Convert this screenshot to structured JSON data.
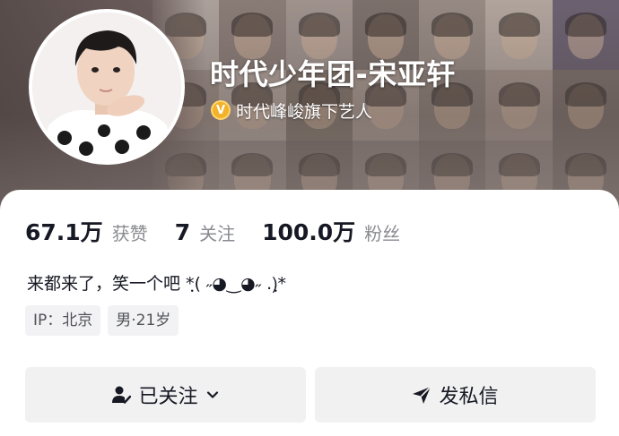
{
  "profile": {
    "nickname": "时代少年团-宋亚轩",
    "verified_badge": "V",
    "verified_text": "时代峰峻旗下艺人",
    "bio": "来都来了，笑一个吧 *ฺ( ˶◕‿◕˶ .)ฺ*"
  },
  "stats": [
    {
      "value": "67.1万",
      "label": "获赞"
    },
    {
      "value": "7",
      "label": "关注"
    },
    {
      "value": "100.0万",
      "label": "粉丝"
    }
  ],
  "tags": [
    {
      "text": "IP：北京"
    },
    {
      "text": "男·21岁"
    }
  ],
  "actions": {
    "follow_label": "已关注",
    "follow_icon": "user-check-icon",
    "follow_chevron_icon": "chevron-down-icon",
    "message_label": "发私信",
    "message_icon": "send-icon"
  },
  "colors": {
    "verified": "#f3b229",
    "text": "#161823",
    "muted": "#8a8b91",
    "button_bg": "#f1f1f2"
  }
}
